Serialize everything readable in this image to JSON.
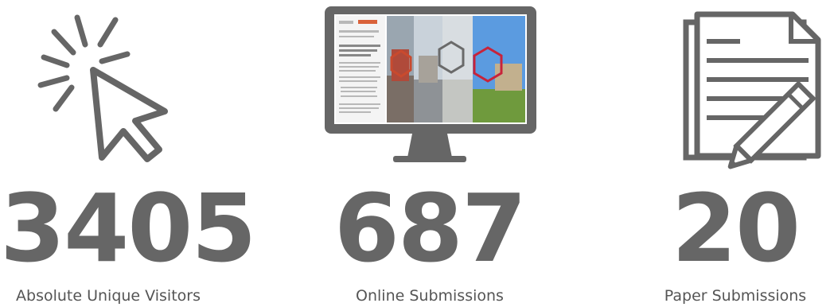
{
  "stats": [
    {
      "value": "3405",
      "label": "Absolute Unique Visitors",
      "icon": "mouse-cursor-click-icon"
    },
    {
      "value": "687",
      "label": "Online Submissions",
      "icon": "computer-monitor-icon"
    },
    {
      "value": "20",
      "label": "Paper Submissions",
      "icon": "paper-document-pen-icon"
    }
  ],
  "colors": {
    "icon_gray": "#666666",
    "text_gray": "#666666",
    "background": "#ffffff"
  }
}
